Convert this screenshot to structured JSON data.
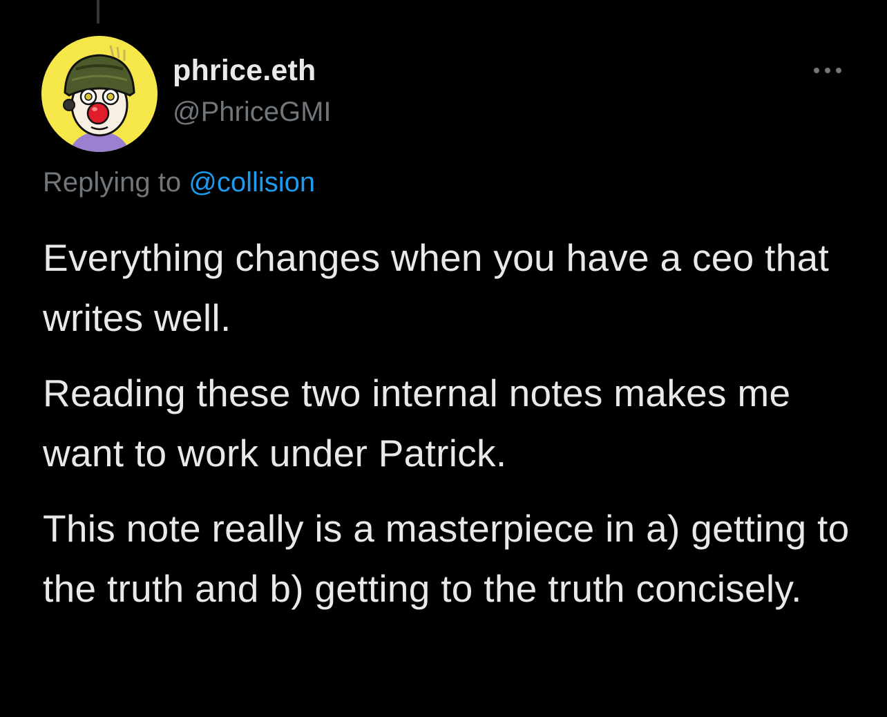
{
  "tweet": {
    "author_name": "phrice.eth",
    "author_handle": "@PhriceGMI",
    "more_icon": "more-horizontal-icon",
    "replying_prefix": "Replying to",
    "replying_to": "@collision",
    "paragraphs": [
      "Everything changes when you have a ceo that writes well.",
      "Reading these two internal notes makes me want to work under Patrick.",
      "This note really is a masterpiece in a) getting to the truth and b) getting to the truth concisely."
    ]
  },
  "colors": {
    "background": "#000000",
    "text_primary": "#e7e9ea",
    "text_secondary": "#71767b",
    "mention": "#1d9bf0",
    "avatar_background": "#f5e64a"
  }
}
